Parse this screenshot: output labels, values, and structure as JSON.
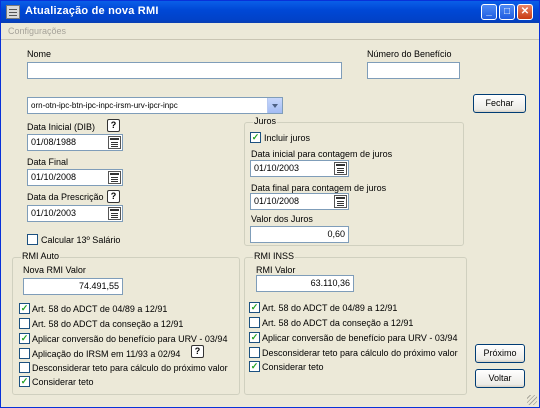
{
  "window": {
    "title": "Atualização de nova RMI",
    "menu": [
      "Configurações"
    ]
  },
  "fields": {
    "nome_label": "Nome",
    "nome_value": "",
    "numero_label": "Número do Benefício",
    "numero_value": "",
    "indice_value": "orn-otn-ipc-btn-ipc-inpc-irsm-urv-ipcr-inpc",
    "data_inicial_label": "Data Inicial (DIB)",
    "data_inicial_value": "01/08/1988",
    "data_final_label": "Data Final",
    "data_final_value": "01/10/2008",
    "data_prescricao_label": "Data da Prescrição",
    "data_prescricao_value": "01/10/2003",
    "calcular_13_label": "Calcular 13º Salário"
  },
  "juros": {
    "title": "Juros",
    "incluir_label": "Incluir juros",
    "data_inicial_label": "Data inicial para contagem de juros",
    "data_inicial_value": "01/10/2003",
    "data_final_label": "Data final para contagem de juros",
    "data_final_value": "01/10/2008",
    "valor_label": "Valor dos Juros",
    "valor_value": "0,60"
  },
  "rmi_auto": {
    "title": "RMI Auto",
    "nova_rmi_label": "Nova RMI Valor",
    "nova_rmi_value": "74.491,55",
    "options": [
      {
        "label": "Art. 58 do ADCT de 04/89 a 12/91",
        "checked": true
      },
      {
        "label": "Art. 58 do ADCT da conseção a 12/91",
        "checked": false
      },
      {
        "label": "Aplicar conversão do benefício para URV - 03/94",
        "checked": true
      },
      {
        "label": "Aplicação do IRSM em 11/93 a 02/94",
        "checked": false
      },
      {
        "label": "Desconsiderar teto para cálculo do próximo valor",
        "checked": false
      },
      {
        "label": "Considerar teto",
        "checked": true
      }
    ]
  },
  "rmi_inss": {
    "title": "RMI INSS",
    "rmi_label": "RMI Valor",
    "rmi_value": "63.110,36",
    "options": [
      {
        "label": "Art. 58 do ADCT de 04/89 a 12/91",
        "checked": true
      },
      {
        "label": "Art. 58 do ADCT da conseção a 12/91",
        "checked": false
      },
      {
        "label": "Aplicar conversão de benefício para URV - 03/94",
        "checked": true
      },
      {
        "label": "Desconsiderar teto para cálculo do próximo valor",
        "checked": false
      },
      {
        "label": "Considerar teto",
        "checked": true
      }
    ]
  },
  "buttons": {
    "fechar": "Fechar",
    "proximo": "Próximo",
    "voltar": "Voltar"
  }
}
